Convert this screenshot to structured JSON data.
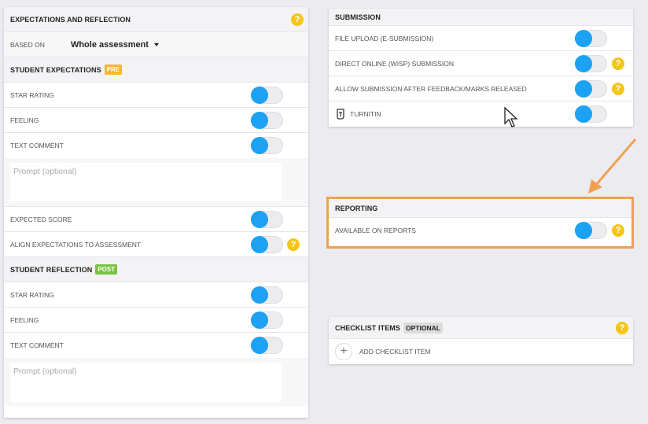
{
  "expectations": {
    "title": "EXPECTATIONS AND REFLECTION",
    "based_on_label": "BASED ON",
    "based_on_value": "Whole assessment",
    "student_expectations": {
      "title": "STUDENT EXPECTATIONS",
      "badge": "PRE",
      "star_rating": "STAR RATING",
      "feeling": "FEELING",
      "text_comment": "TEXT COMMENT",
      "prompt_placeholder": "Prompt (optional)",
      "expected_score": "EXPECTED SCORE",
      "align": "ALIGN EXPECTATIONS TO ASSESSMENT"
    },
    "student_reflection": {
      "title": "STUDENT REFLECTION",
      "badge": "POST",
      "star_rating": "STAR RATING",
      "feeling": "FEELING",
      "text_comment": "TEXT COMMENT",
      "prompt_placeholder": "Prompt (optional)"
    }
  },
  "submission": {
    "title": "SUBMISSION",
    "file_upload": "FILE UPLOAD (E-SUBMISSION)",
    "direct_online": "DIRECT ONLINE (WISP) SUBMISSION",
    "allow_after": "ALLOW SUBMISSION AFTER FEEDBACK/MARKS RELEASED",
    "turnitin": "TURNITIN"
  },
  "reporting": {
    "title": "REPORTING",
    "available": "AVAILABLE ON REPORTS"
  },
  "checklist": {
    "title": "CHECKLIST ITEMS",
    "badge": "OPTIONAL",
    "add_label": "ADD CHECKLIST ITEM"
  },
  "help_symbol": "?",
  "colors": {
    "toggle_knob": "#1da1f2",
    "help_icon": "#f5c518",
    "pre_badge": "#f5b82e",
    "post_badge": "#7cc243",
    "highlight": "#f0a050"
  }
}
